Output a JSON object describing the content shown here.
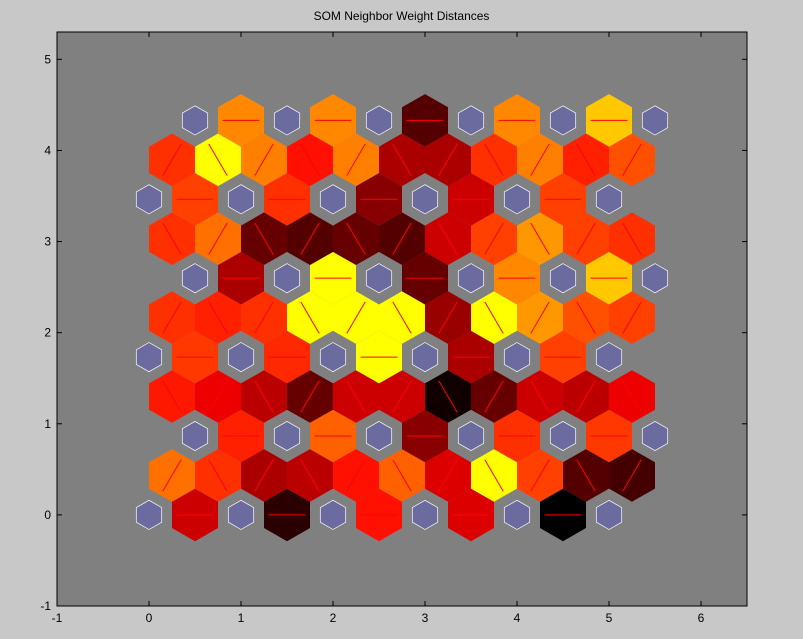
{
  "chart_data": {
    "type": "heatmap",
    "title": "SOM Neighbor Weight Distances",
    "xlabel": "",
    "ylabel": "",
    "xlim": [
      -1,
      6.5
    ],
    "ylim": [
      -1,
      5.3
    ],
    "xticks": [
      -1,
      0,
      1,
      2,
      3,
      4,
      5,
      6
    ],
    "yticks": [
      -1,
      0,
      1,
      2,
      3,
      4,
      5
    ],
    "grid": false,
    "colors": {
      "figure_background": "#c8c8c8",
      "axes_background": "#808080",
      "neuron": "#6b6b9f",
      "connection_line": "#ff0000",
      "colormap": "hot"
    },
    "neurons": [
      [
        0,
        0
      ],
      [
        1,
        0
      ],
      [
        2,
        0
      ],
      [
        3,
        0
      ],
      [
        4,
        0
      ],
      [
        5,
        0
      ],
      [
        0.5,
        0.866
      ],
      [
        1.5,
        0.866
      ],
      [
        2.5,
        0.866
      ],
      [
        3.5,
        0.866
      ],
      [
        4.5,
        0.866
      ],
      [
        5.5,
        0.866
      ],
      [
        0,
        1.732
      ],
      [
        1,
        1.732
      ],
      [
        2,
        1.732
      ],
      [
        3,
        1.732
      ],
      [
        4,
        1.732
      ],
      [
        5,
        1.732
      ],
      [
        0.5,
        2.598
      ],
      [
        1.5,
        2.598
      ],
      [
        2.5,
        2.598
      ],
      [
        3.5,
        2.598
      ],
      [
        4.5,
        2.598
      ],
      [
        5.5,
        2.598
      ],
      [
        0,
        3.464
      ],
      [
        1,
        3.464
      ],
      [
        2,
        3.464
      ],
      [
        3,
        3.464
      ],
      [
        4,
        3.464
      ],
      [
        5,
        3.464
      ],
      [
        0.5,
        4.33
      ],
      [
        1.5,
        4.33
      ],
      [
        2.5,
        4.33
      ],
      [
        3.5,
        4.33
      ],
      [
        4.5,
        4.33
      ],
      [
        5.5,
        4.33
      ]
    ],
    "distance_colors": [
      {
        "x": 0.5,
        "y": 0,
        "color": "#cc0000"
      },
      {
        "x": 1.5,
        "y": 0,
        "color": "#2a0000"
      },
      {
        "x": 2.5,
        "y": 0,
        "color": "#ff1000"
      },
      {
        "x": 3.5,
        "y": 0,
        "color": "#dd0000"
      },
      {
        "x": 4.5,
        "y": 0,
        "color": "#000000"
      },
      {
        "x": 0.25,
        "y": 0.433,
        "color": "#ff7000"
      },
      {
        "x": 0.75,
        "y": 0.433,
        "color": "#ff3000"
      },
      {
        "x": 1.25,
        "y": 0.433,
        "color": "#aa0000"
      },
      {
        "x": 1.75,
        "y": 0.433,
        "color": "#bb0000"
      },
      {
        "x": 2.25,
        "y": 0.433,
        "color": "#ff1000"
      },
      {
        "x": 2.75,
        "y": 0.433,
        "color": "#ff6000"
      },
      {
        "x": 3.25,
        "y": 0.433,
        "color": "#dd0000"
      },
      {
        "x": 3.75,
        "y": 0.433,
        "color": "#ffff00"
      },
      {
        "x": 4.25,
        "y": 0.433,
        "color": "#ff4000"
      },
      {
        "x": 4.75,
        "y": 0.433,
        "color": "#550000"
      },
      {
        "x": 5.25,
        "y": 0.433,
        "color": "#440000"
      },
      {
        "x": 1,
        "y": 0.866,
        "color": "#ff2000"
      },
      {
        "x": 2,
        "y": 0.866,
        "color": "#ff6000"
      },
      {
        "x": 3,
        "y": 0.866,
        "color": "#880000"
      },
      {
        "x": 4,
        "y": 0.866,
        "color": "#ff3000"
      },
      {
        "x": 5,
        "y": 0.866,
        "color": "#ff3800"
      },
      {
        "x": 0.25,
        "y": 1.299,
        "color": "#ff1800"
      },
      {
        "x": 0.75,
        "y": 1.299,
        "color": "#ee0000"
      },
      {
        "x": 1.25,
        "y": 1.299,
        "color": "#bb0000"
      },
      {
        "x": 1.75,
        "y": 1.299,
        "color": "#660000"
      },
      {
        "x": 2.25,
        "y": 1.299,
        "color": "#cc0000"
      },
      {
        "x": 2.75,
        "y": 1.299,
        "color": "#cc0000"
      },
      {
        "x": 3.25,
        "y": 1.299,
        "color": "#100000"
      },
      {
        "x": 3.75,
        "y": 1.299,
        "color": "#660000"
      },
      {
        "x": 4.25,
        "y": 1.299,
        "color": "#cc0000"
      },
      {
        "x": 4.75,
        "y": 1.299,
        "color": "#bb0000"
      },
      {
        "x": 5.25,
        "y": 1.299,
        "color": "#ee0000"
      },
      {
        "x": 0.5,
        "y": 1.732,
        "color": "#ff3800"
      },
      {
        "x": 1.5,
        "y": 1.732,
        "color": "#ff2800"
      },
      {
        "x": 2.5,
        "y": 1.732,
        "color": "#ffff00"
      },
      {
        "x": 3.5,
        "y": 1.732,
        "color": "#aa0000"
      },
      {
        "x": 4.5,
        "y": 1.732,
        "color": "#ff4000"
      },
      {
        "x": 0.25,
        "y": 2.165,
        "color": "#ff3000"
      },
      {
        "x": 0.75,
        "y": 2.165,
        "color": "#ff2000"
      },
      {
        "x": 1.25,
        "y": 2.165,
        "color": "#ff3000"
      },
      {
        "x": 1.75,
        "y": 2.165,
        "color": "#ffff00"
      },
      {
        "x": 2.25,
        "y": 2.165,
        "color": "#ffff00"
      },
      {
        "x": 2.75,
        "y": 2.165,
        "color": "#ffff00"
      },
      {
        "x": 3.25,
        "y": 2.165,
        "color": "#990000"
      },
      {
        "x": 3.75,
        "y": 2.165,
        "color": "#ffff00"
      },
      {
        "x": 4.25,
        "y": 2.165,
        "color": "#ff9800"
      },
      {
        "x": 4.75,
        "y": 2.165,
        "color": "#ff5000"
      },
      {
        "x": 5.25,
        "y": 2.165,
        "color": "#ff4000"
      },
      {
        "x": 1,
        "y": 2.598,
        "color": "#aa0000"
      },
      {
        "x": 2,
        "y": 2.598,
        "color": "#ffff00"
      },
      {
        "x": 3,
        "y": 2.598,
        "color": "#660000"
      },
      {
        "x": 4,
        "y": 2.598,
        "color": "#ff8800"
      },
      {
        "x": 5,
        "y": 2.598,
        "color": "#ffc800"
      },
      {
        "x": 0.25,
        "y": 3.031,
        "color": "#ff3000"
      },
      {
        "x": 0.75,
        "y": 3.031,
        "color": "#ff7000"
      },
      {
        "x": 1.25,
        "y": 3.031,
        "color": "#660000"
      },
      {
        "x": 1.75,
        "y": 3.031,
        "color": "#550000"
      },
      {
        "x": 2.25,
        "y": 3.031,
        "color": "#660000"
      },
      {
        "x": 2.75,
        "y": 3.031,
        "color": "#550000"
      },
      {
        "x": 3.25,
        "y": 3.031,
        "color": "#cc0000"
      },
      {
        "x": 3.75,
        "y": 3.031,
        "color": "#ff4000"
      },
      {
        "x": 4.25,
        "y": 3.031,
        "color": "#ff9800"
      },
      {
        "x": 4.75,
        "y": 3.031,
        "color": "#ff4000"
      },
      {
        "x": 5.25,
        "y": 3.031,
        "color": "#ff3000"
      },
      {
        "x": 0.5,
        "y": 3.464,
        "color": "#ff4000"
      },
      {
        "x": 1.5,
        "y": 3.464,
        "color": "#ff3000"
      },
      {
        "x": 2.5,
        "y": 3.464,
        "color": "#880000"
      },
      {
        "x": 3.5,
        "y": 3.464,
        "color": "#cc0000"
      },
      {
        "x": 4.5,
        "y": 3.464,
        "color": "#ff4000"
      },
      {
        "x": 0.25,
        "y": 3.897,
        "color": "#ff3000"
      },
      {
        "x": 0.75,
        "y": 3.897,
        "color": "#ffff00"
      },
      {
        "x": 1.25,
        "y": 3.897,
        "color": "#ff8000"
      },
      {
        "x": 1.75,
        "y": 3.897,
        "color": "#ff1000"
      },
      {
        "x": 2.25,
        "y": 3.897,
        "color": "#ff8000"
      },
      {
        "x": 2.75,
        "y": 3.897,
        "color": "#aa0000"
      },
      {
        "x": 3.25,
        "y": 3.897,
        "color": "#aa0000"
      },
      {
        "x": 3.75,
        "y": 3.897,
        "color": "#ff3000"
      },
      {
        "x": 4.25,
        "y": 3.897,
        "color": "#ff8000"
      },
      {
        "x": 4.75,
        "y": 3.897,
        "color": "#ff2000"
      },
      {
        "x": 5.25,
        "y": 3.897,
        "color": "#ff5000"
      },
      {
        "x": 1,
        "y": 4.33,
        "color": "#ff8800"
      },
      {
        "x": 2,
        "y": 4.33,
        "color": "#ff8800"
      },
      {
        "x": 3,
        "y": 4.33,
        "color": "#550000"
      },
      {
        "x": 4,
        "y": 4.33,
        "color": "#ff8800"
      },
      {
        "x": 5,
        "y": 4.33,
        "color": "#ffc800"
      }
    ]
  }
}
